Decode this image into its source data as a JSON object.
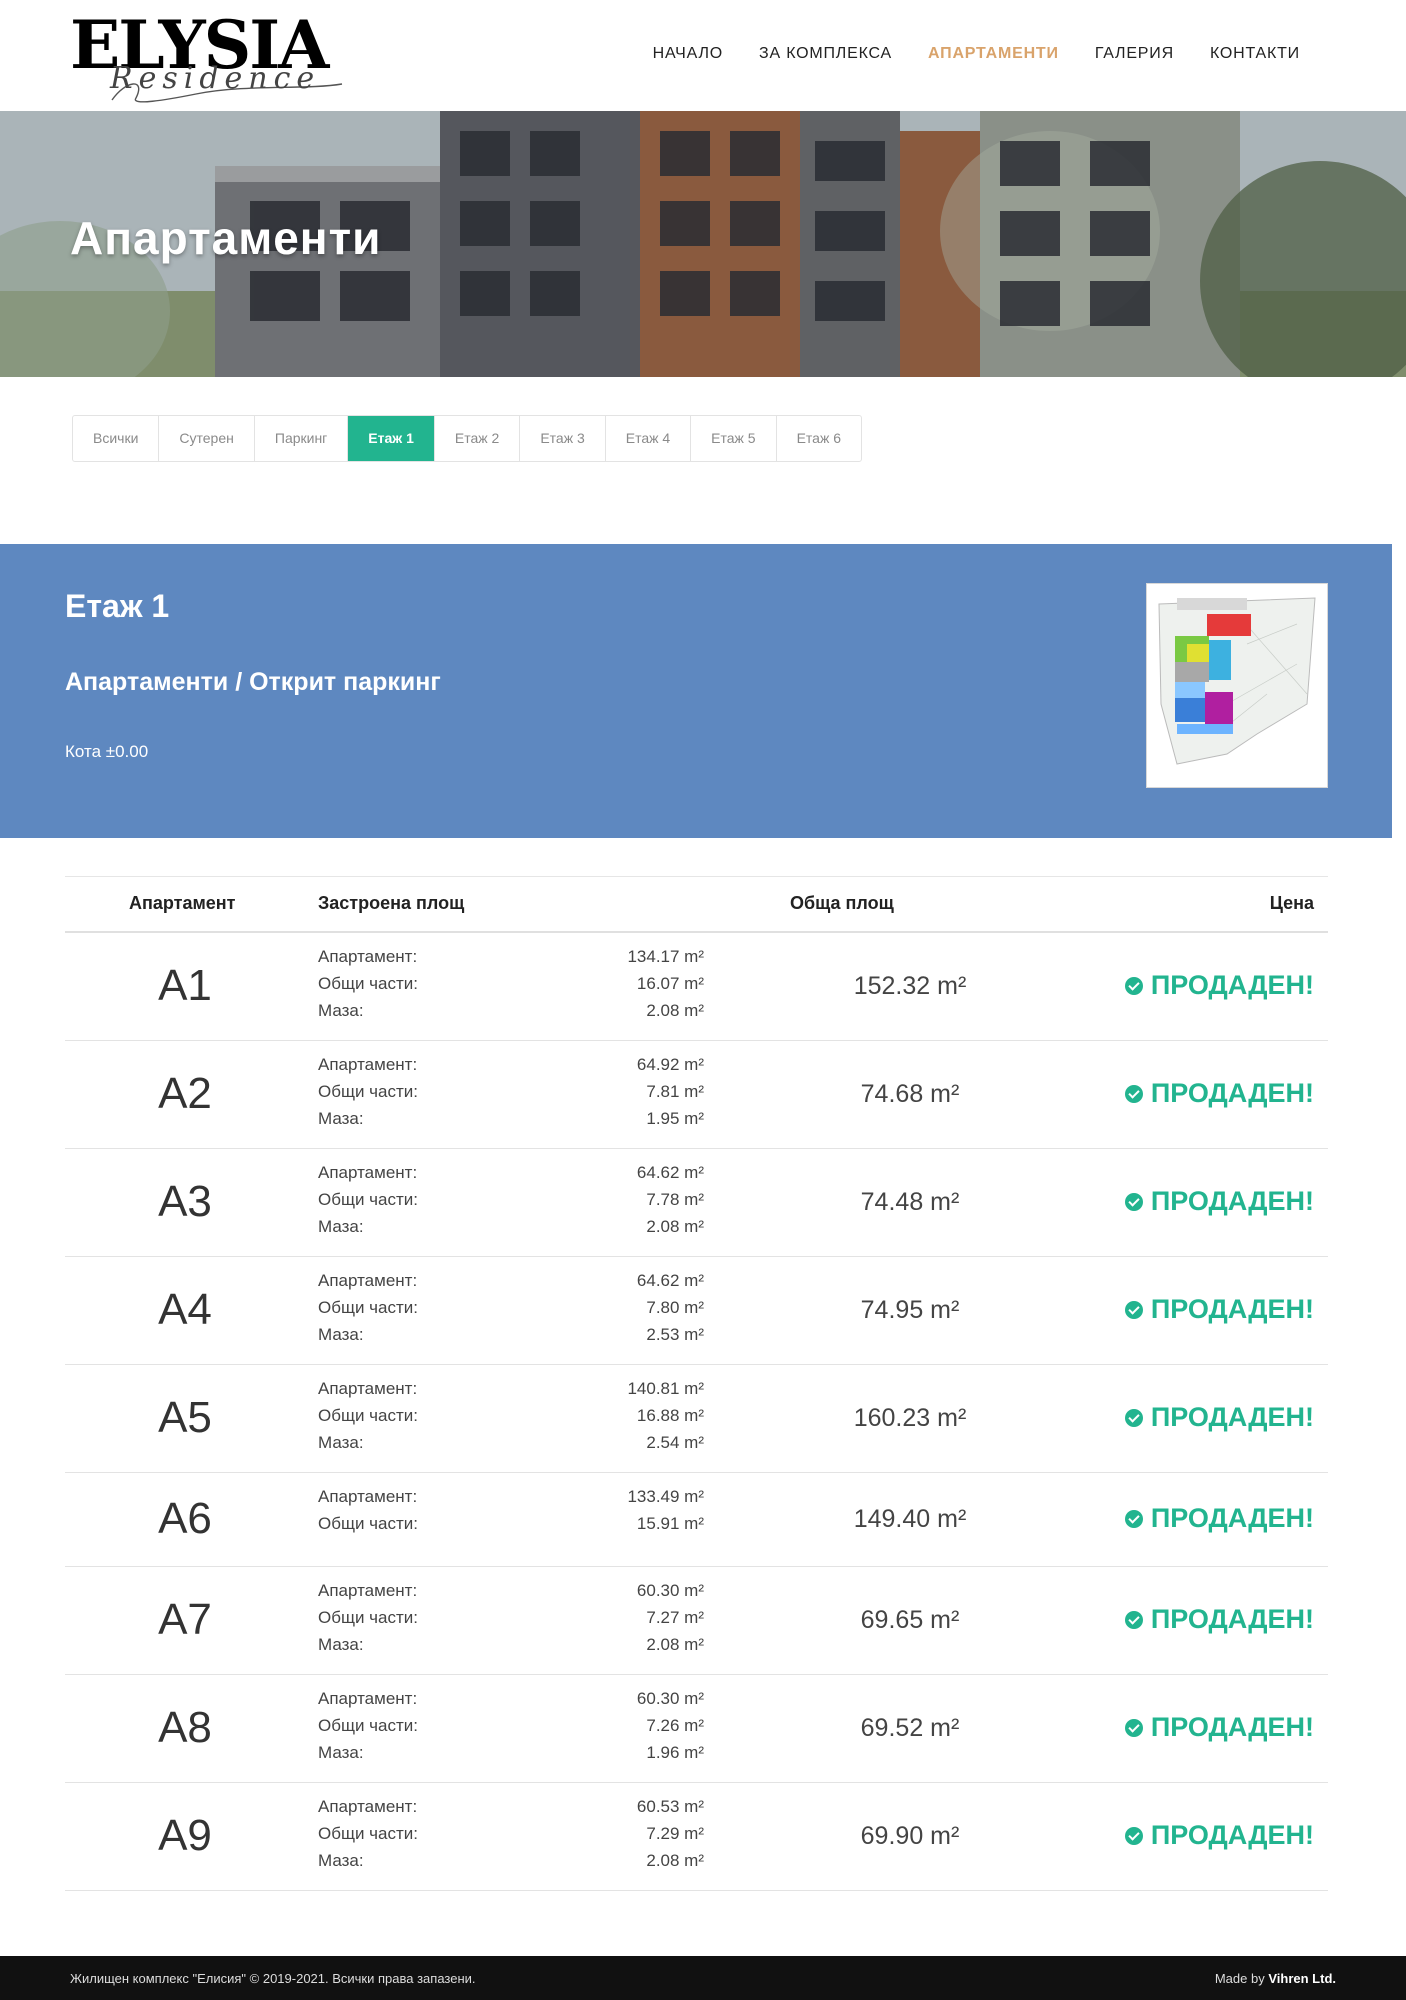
{
  "brand": {
    "name": "ELYSIA",
    "tagline": "Residence"
  },
  "nav": [
    {
      "label": "НАЧАЛО",
      "active": false
    },
    {
      "label": "ЗА КОМПЛЕКСА",
      "active": false
    },
    {
      "label": "АПАРТАМЕНТИ",
      "active": true
    },
    {
      "label": "ГАЛЕРИЯ",
      "active": false
    },
    {
      "label": "КОНТАКТИ",
      "active": false
    }
  ],
  "hero": {
    "title": "Апартаменти"
  },
  "tabs": [
    {
      "label": "Всички",
      "active": false
    },
    {
      "label": "Сутерен",
      "active": false
    },
    {
      "label": "Паркинг",
      "active": false
    },
    {
      "label": "Етаж 1",
      "active": true
    },
    {
      "label": "Етаж 2",
      "active": false
    },
    {
      "label": "Етаж 3",
      "active": false
    },
    {
      "label": "Етаж 4",
      "active": false
    },
    {
      "label": "Етаж 5",
      "active": false
    },
    {
      "label": "Етаж 6",
      "active": false
    }
  ],
  "floor": {
    "title": "Етаж 1",
    "subtitle": "Апартаменти / Открит паркинг",
    "level": "Кота ±0.00"
  },
  "table": {
    "headers": {
      "apartment": "Апартамент",
      "built": "Застроена площ",
      "total": "Обща площ",
      "price": "Цена"
    },
    "rows": [
      {
        "apt": "A1",
        "areas": [
          {
            "label": "Апартамент:",
            "value": "134.17 m²"
          },
          {
            "label": "Общи части:",
            "value": "16.07 m²"
          },
          {
            "label": "Маза:",
            "value": "2.08 m²"
          }
        ],
        "total": "152.32 m²",
        "status": "ПРОДАДЕН!"
      },
      {
        "apt": "A2",
        "areas": [
          {
            "label": "Апартамент:",
            "value": "64.92 m²"
          },
          {
            "label": "Общи части:",
            "value": "7.81 m²"
          },
          {
            "label": "Маза:",
            "value": "1.95 m²"
          }
        ],
        "total": "74.68 m²",
        "status": "ПРОДАДЕН!"
      },
      {
        "apt": "A3",
        "areas": [
          {
            "label": "Апартамент:",
            "value": "64.62 m²"
          },
          {
            "label": "Общи части:",
            "value": "7.78 m²"
          },
          {
            "label": "Маза:",
            "value": "2.08 m²"
          }
        ],
        "total": "74.48 m²",
        "status": "ПРОДАДЕН!"
      },
      {
        "apt": "A4",
        "areas": [
          {
            "label": "Апартамент:",
            "value": "64.62 m²"
          },
          {
            "label": "Общи части:",
            "value": "7.80 m²"
          },
          {
            "label": "Маза:",
            "value": "2.53 m²"
          }
        ],
        "total": "74.95 m²",
        "status": "ПРОДАДЕН!"
      },
      {
        "apt": "A5",
        "areas": [
          {
            "label": "Апартамент:",
            "value": "140.81 m²"
          },
          {
            "label": "Общи части:",
            "value": "16.88 m²"
          },
          {
            "label": "Маза:",
            "value": "2.54 m²"
          }
        ],
        "total": "160.23 m²",
        "status": "ПРОДАДЕН!"
      },
      {
        "apt": "A6",
        "areas": [
          {
            "label": "Апартамент:",
            "value": "133.49 m²"
          },
          {
            "label": "Общи части:",
            "value": "15.91 m²"
          }
        ],
        "total": "149.40 m²",
        "status": "ПРОДАДЕН!"
      },
      {
        "apt": "A7",
        "areas": [
          {
            "label": "Апартамент:",
            "value": "60.30 m²"
          },
          {
            "label": "Общи части:",
            "value": "7.27 m²"
          },
          {
            "label": "Маза:",
            "value": "2.08 m²"
          }
        ],
        "total": "69.65 m²",
        "status": "ПРОДАДЕН!"
      },
      {
        "apt": "A8",
        "areas": [
          {
            "label": "Апартамент:",
            "value": "60.30 m²"
          },
          {
            "label": "Общи части:",
            "value": "7.26 m²"
          },
          {
            "label": "Маза:",
            "value": "1.96 m²"
          }
        ],
        "total": "69.52 m²",
        "status": "ПРОДАДЕН!"
      },
      {
        "apt": "A9",
        "areas": [
          {
            "label": "Апартамент:",
            "value": "60.53 m²"
          },
          {
            "label": "Общи части:",
            "value": "7.29 m²"
          },
          {
            "label": "Маза:",
            "value": "2.08 m²"
          }
        ],
        "total": "69.90 m²",
        "status": "ПРОДАДЕН!"
      }
    ]
  },
  "footer": {
    "copyright": "Жилищен комплекс \"Елисия\" © 2019-2021. Всички права запазени.",
    "made_by_prefix": "Made by",
    "made_by_company": "Vihren Ltd."
  },
  "colors": {
    "accent": "#22b48f",
    "nav_active": "#d9a36b",
    "floor_panel": "#5e88c0",
    "footer": "#111111"
  }
}
